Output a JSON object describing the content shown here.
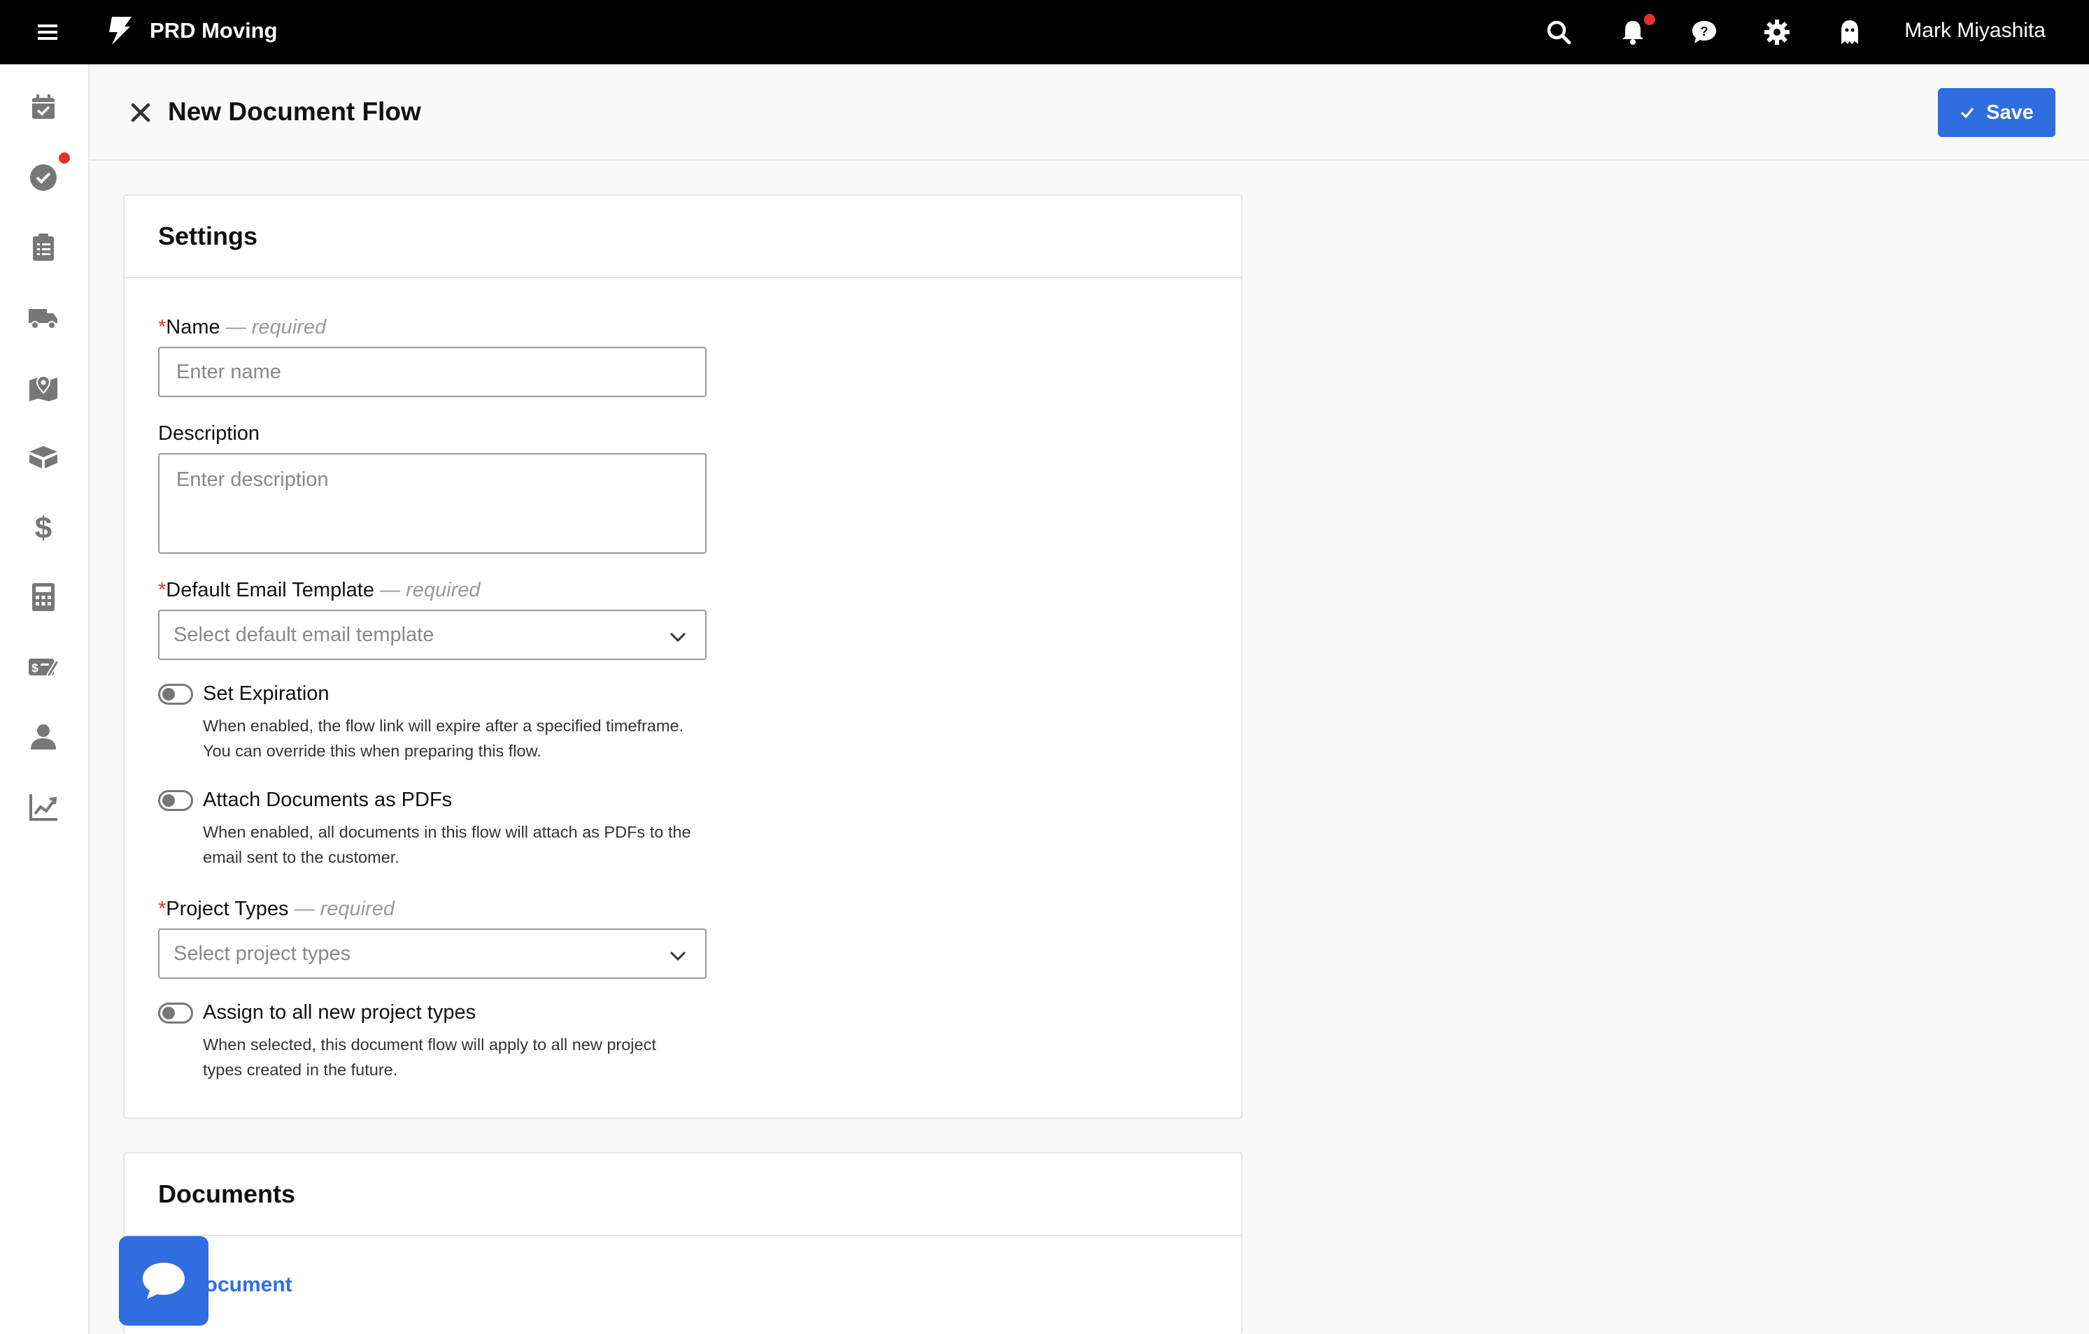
{
  "app": {
    "brand": "PRD Moving",
    "user_name": "Mark Miyashita",
    "accent_color": "#2f6de1",
    "notification_dot_color": "#e53030"
  },
  "topbar": {
    "icons": [
      "menu-icon",
      "logo-icon",
      "search-icon",
      "bell-icon",
      "chat-help-icon",
      "gear-icon",
      "ghost-icon"
    ]
  },
  "sidebar": {
    "items": [
      "calendar-check-icon",
      "check-circle-icon",
      "clipboard-icon",
      "truck-icon",
      "map-pin-icon",
      "boxes-icon",
      "dollar-icon",
      "calculator-icon",
      "dollar-edit-icon",
      "user-icon",
      "chart-line-icon"
    ]
  },
  "header": {
    "title": "New Document Flow",
    "save_label": "Save"
  },
  "settings": {
    "title": "Settings",
    "required_suffix": " — required",
    "name_label": "Name",
    "name_placeholder": "Enter name",
    "description_label": "Description",
    "description_placeholder": "Enter description",
    "email_template_label": "Default Email Template",
    "email_template_placeholder": "Select default email template",
    "expiration_label": "Set Expiration",
    "expiration_help": "When enabled, the flow link will expire after a specified timeframe. You can override this when preparing this flow.",
    "attach_pdf_label": "Attach Documents as PDFs",
    "attach_pdf_help": "When enabled, all documents in this flow will attach as PDFs to the email sent to the customer.",
    "project_types_label": "Project Types",
    "project_types_placeholder": "Select project types",
    "assign_all_label": "Assign to all new project types",
    "assign_all_help": "When selected, this document flow will apply to all new project types created in the future."
  },
  "documents": {
    "title": "Documents",
    "add_label": "dd Document"
  }
}
